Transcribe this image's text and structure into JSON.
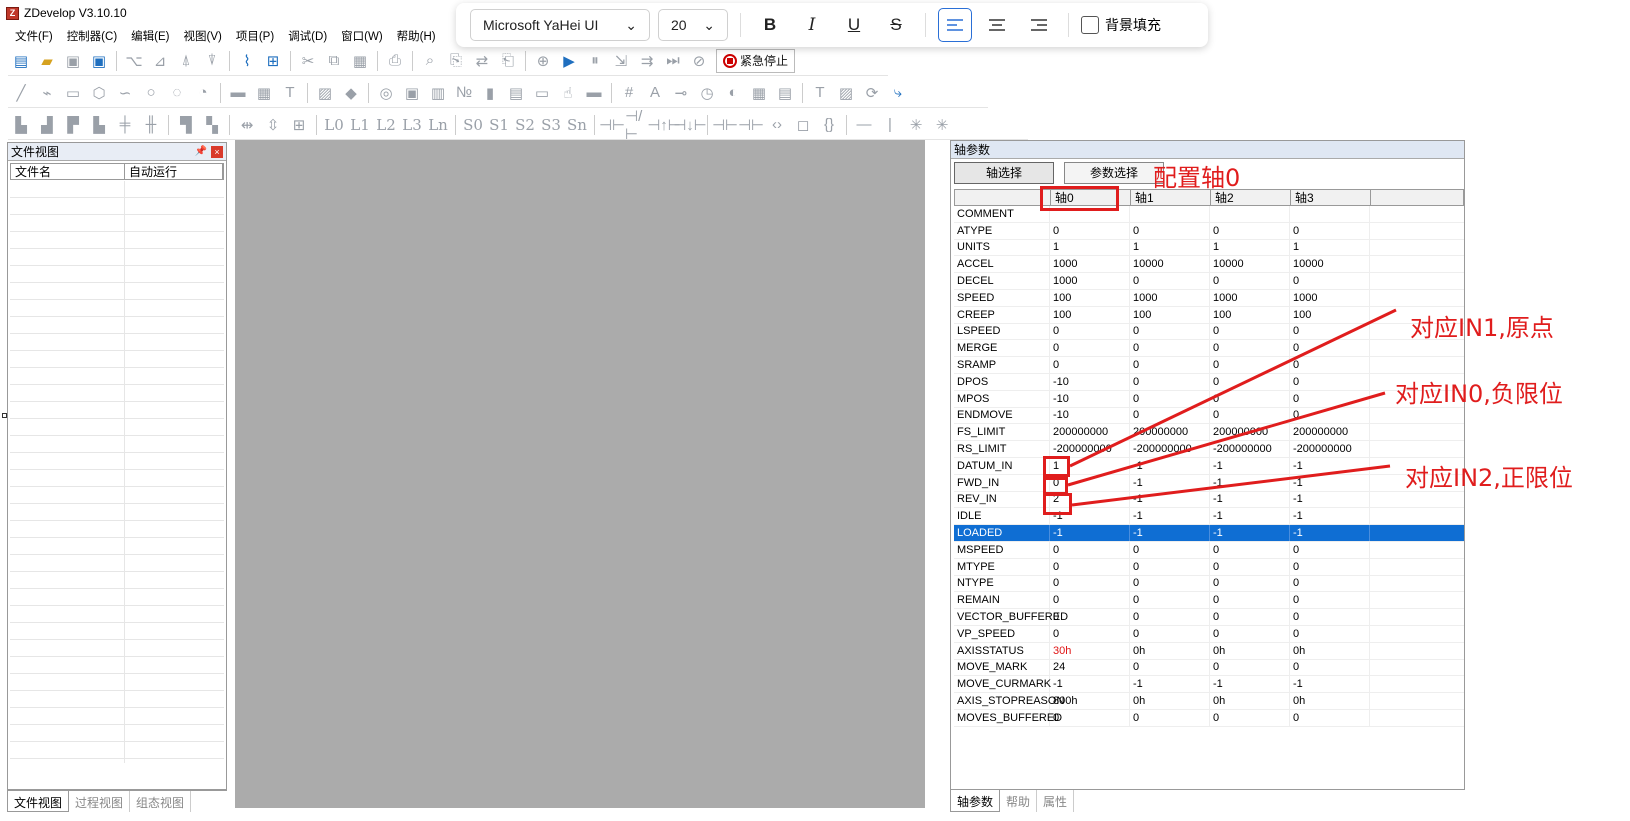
{
  "app": {
    "title": "ZDevelop V3.10.10"
  },
  "menu": [
    "文件(F)",
    "控制器(C)",
    "编辑(E)",
    "视图(V)",
    "项目(P)",
    "调试(D)",
    "窗口(W)",
    "帮助(H)"
  ],
  "format_toolbar": {
    "font": "Microsoft YaHei UI",
    "size": "20",
    "bold": "B",
    "italic": "I",
    "underline": "U",
    "strike": "S",
    "fill_label": "背景填充"
  },
  "toolbar": {
    "estop_label": "紧急停止"
  },
  "toolbar3": {
    "labels": [
      "L0",
      "L1",
      "L2",
      "L3",
      "Ln",
      "S0",
      "S1",
      "S2",
      "S3",
      "Sn"
    ]
  },
  "file_panel": {
    "title": "文件视图",
    "col_name": "文件名",
    "col_autorun": "自动运行",
    "tabs": [
      "文件视图",
      "过程视图",
      "组态视图"
    ]
  },
  "axis_panel": {
    "title": "轴参数",
    "btn_axis_select": "轴选择",
    "btn_param_select": "参数选择",
    "columns": [
      "轴0",
      "轴1",
      "轴2",
      "轴3"
    ],
    "selected_row": "LOADED",
    "rows": [
      [
        "COMMENT",
        "",
        "",
        "",
        ""
      ],
      [
        "ATYPE",
        "0",
        "0",
        "0",
        "0"
      ],
      [
        "UNITS",
        "1",
        "1",
        "1",
        "1"
      ],
      [
        "ACCEL",
        "1000",
        "10000",
        "10000",
        "10000"
      ],
      [
        "DECEL",
        "1000",
        "0",
        "0",
        "0"
      ],
      [
        "SPEED",
        "100",
        "1000",
        "1000",
        "1000"
      ],
      [
        "CREEP",
        "100",
        "100",
        "100",
        "100"
      ],
      [
        "LSPEED",
        "0",
        "0",
        "0",
        "0"
      ],
      [
        "MERGE",
        "0",
        "0",
        "0",
        "0"
      ],
      [
        "SRAMP",
        "0",
        "0",
        "0",
        "0"
      ],
      [
        "DPOS",
        "-10",
        "0",
        "0",
        "0"
      ],
      [
        "MPOS",
        "-10",
        "0",
        "0",
        "0"
      ],
      [
        "ENDMOVE",
        "-10",
        "0",
        "0",
        "0"
      ],
      [
        "FS_LIMIT",
        "200000000",
        "200000000",
        "200000000",
        "200000000"
      ],
      [
        "RS_LIMIT",
        "-200000000",
        "-200000000",
        "-200000000",
        "-200000000"
      ],
      [
        "DATUM_IN",
        "1",
        "-1",
        "-1",
        "-1"
      ],
      [
        "FWD_IN",
        "0",
        "-1",
        "-1",
        "-1"
      ],
      [
        "REV_IN",
        "2",
        "-1",
        "-1",
        "-1"
      ],
      [
        "IDLE",
        "-1",
        "-1",
        "-1",
        "-1"
      ],
      [
        "LOADED",
        "-1",
        "-1",
        "-1",
        "-1"
      ],
      [
        "MSPEED",
        "0",
        "0",
        "0",
        "0"
      ],
      [
        "MTYPE",
        "0",
        "0",
        "0",
        "0"
      ],
      [
        "NTYPE",
        "0",
        "0",
        "0",
        "0"
      ],
      [
        "REMAIN",
        "0",
        "0",
        "0",
        "0"
      ],
      [
        "VECTOR_BUFFERED",
        "0",
        "0",
        "0",
        "0"
      ],
      [
        "VP_SPEED",
        "0",
        "0",
        "0",
        "0"
      ],
      [
        "AXISSTATUS",
        "30h",
        "0h",
        "0h",
        "0h"
      ],
      [
        "MOVE_MARK",
        "24",
        "0",
        "0",
        "0"
      ],
      [
        "MOVE_CURMARK",
        "-1",
        "-1",
        "-1",
        "-1"
      ],
      [
        "AXIS_STOPREASON",
        "800h",
        "0h",
        "0h",
        "0h"
      ],
      [
        "MOVES_BUFFERED",
        "0",
        "0",
        "0",
        "0"
      ]
    ],
    "tabs": [
      "轴参数",
      "帮助",
      "属性"
    ]
  },
  "annotations": {
    "config": "配置轴0",
    "in1": "对应IN1,原点",
    "in0": "对应IN0,负限位",
    "in2": "对应IN2,正限位"
  },
  "colors": {
    "annotation": "#e01d1d",
    "selection": "#0f6ed3",
    "status_red": "#e01515"
  }
}
